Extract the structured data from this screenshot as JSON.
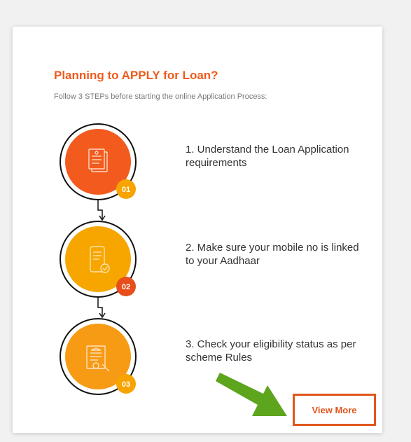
{
  "card": {
    "title": "Planning to APPLY for Loan?",
    "subtitle": "Follow 3 STEPs before starting the online Application Process:"
  },
  "steps": [
    {
      "badge": "01",
      "text": "1. Understand the Loan Application requirements",
      "color": "#f25a1e",
      "badge_color": "#f7a400",
      "icon": "documents-icon"
    },
    {
      "badge": "02",
      "text": "2. Make sure your mobile no is linked to your Aadhaar",
      "color": "#f7a600",
      "badge_color": "#e84e1b",
      "icon": "mobile-check-icon"
    },
    {
      "badge": "03",
      "text": "3. Check your eligibility status as per scheme Rules",
      "color": "#f79b14",
      "badge_color": "#f7a400",
      "icon": "certificate-icon"
    }
  ],
  "cta": {
    "label": "View More",
    "border_color": "#e1561d",
    "arrow_color": "#5ea51e"
  }
}
